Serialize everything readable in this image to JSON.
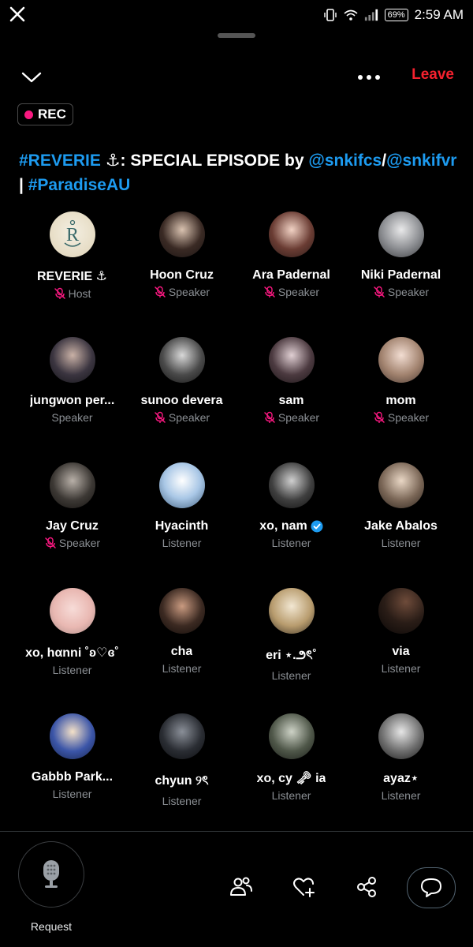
{
  "status_bar": {
    "battery": "69%",
    "time": "2:59 AM",
    "icons": [
      "x-logo-icon",
      "vibrate-icon",
      "wifi-icon",
      "signal-icon",
      "battery-icon"
    ]
  },
  "header": {
    "leave_label": "Leave",
    "rec_label": "REC"
  },
  "space": {
    "title_part1": "#REVERIE",
    "title_part2": " ⚓: SPECIAL EPISODE by ",
    "title_link1": "@snkifcs",
    "title_sep": "/",
    "title_link2": "@snkifvr",
    "title_sep2": " | ",
    "title_link3": "#ParadiseAU"
  },
  "participants": [
    {
      "name": "REVERIE ⚓",
      "role": "Host",
      "muted": true
    },
    {
      "name": "Hoon Cruz",
      "role": "Speaker",
      "muted": true
    },
    {
      "name": "Ara Padernal",
      "role": "Speaker",
      "muted": true
    },
    {
      "name": "Niki Padernal",
      "role": "Speaker",
      "muted": true
    },
    {
      "name": "jungwon per...",
      "role": "Speaker",
      "muted": false
    },
    {
      "name": "sunoo devera",
      "role": "Speaker",
      "muted": true
    },
    {
      "name": "sam",
      "role": "Speaker",
      "muted": true
    },
    {
      "name": "mom",
      "role": "Speaker",
      "muted": true
    },
    {
      "name": "Jay Cruz",
      "role": "Speaker",
      "muted": true
    },
    {
      "name": "Hyacinth",
      "role": "Listener",
      "muted": false
    },
    {
      "name": "xo, nam",
      "role": "Listener",
      "muted": false,
      "verified": true
    },
    {
      "name": "Jake Abalos",
      "role": "Listener",
      "muted": false
    },
    {
      "name": "xo, hαnni ˚ʚ♡ɞ˚",
      "role": "Listener",
      "muted": false
    },
    {
      "name": "cha",
      "role": "Listener",
      "muted": false
    },
    {
      "name": "eri ⋆.౨ৎ˚",
      "role": "Listener",
      "muted": false
    },
    {
      "name": "via",
      "role": "Listener",
      "muted": false
    },
    {
      "name": "Gabbb Park...",
      "role": "Listener",
      "muted": false
    },
    {
      "name": "chyun ୨ৎ",
      "role": "Listener",
      "muted": false
    },
    {
      "name": "xo, cy 🗝 ia",
      "role": "Listener",
      "muted": false
    },
    {
      "name": "ayaz⋆",
      "role": "Listener",
      "muted": false
    }
  ],
  "bottom_bar": {
    "request_label": "Request",
    "icons": [
      "microphone-icon",
      "people-icon",
      "heart-plus-icon",
      "share-icon",
      "chat-icon"
    ]
  },
  "colors": {
    "accent_blue": "#1d9bf0",
    "leave_red": "#f4212e",
    "rec_pink": "#f91880",
    "muted_pink": "#f91880",
    "secondary_text": "#8b8f94"
  }
}
